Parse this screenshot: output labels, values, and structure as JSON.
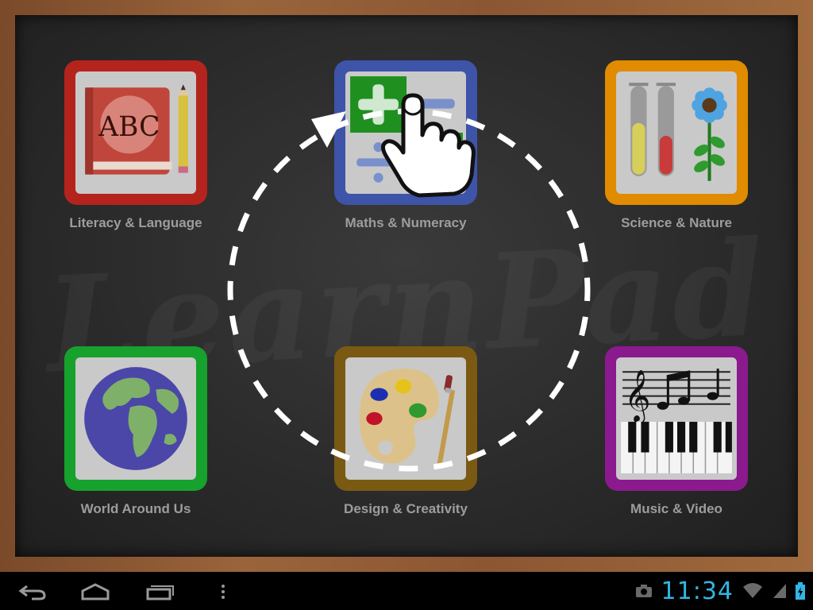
{
  "app": {
    "watermark": "LearnPad"
  },
  "tiles": [
    {
      "label": "Literacy & Language",
      "border": "#b5231d",
      "icon": "book-abc-icon",
      "book_text": "ABC"
    },
    {
      "label": "Maths & Numeracy",
      "border": "#3d54a8",
      "icon": "math-symbols-icon"
    },
    {
      "label": "Science & Nature",
      "border": "#e08b00",
      "icon": "test-tubes-flower-icon"
    },
    {
      "label": "World Around Us",
      "border": "#17a12d",
      "icon": "globe-icon"
    },
    {
      "label": "Design & Creativity",
      "border": "#7a5a12",
      "icon": "paint-palette-icon"
    },
    {
      "label": "Music & Video",
      "border": "#8b1a8e",
      "icon": "music-piano-icon"
    }
  ],
  "navbar": {
    "time": "11:34",
    "buttons": [
      "back-icon",
      "home-icon",
      "recent-apps-icon",
      "menu-icon"
    ],
    "status_icons": [
      "camera-icon",
      "wifi-icon",
      "signal-icon",
      "battery-icon"
    ]
  }
}
